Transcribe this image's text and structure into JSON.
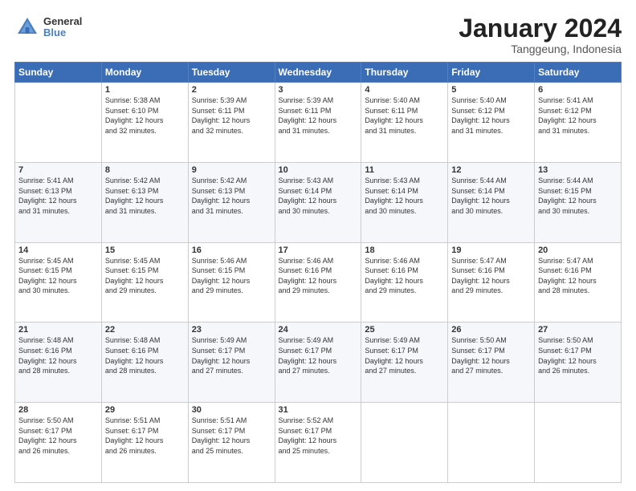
{
  "header": {
    "logo_line1": "General",
    "logo_line2": "Blue",
    "title": "January 2024",
    "subtitle": "Tanggeung, Indonesia"
  },
  "calendar": {
    "days_of_week": [
      "Sunday",
      "Monday",
      "Tuesday",
      "Wednesday",
      "Thursday",
      "Friday",
      "Saturday"
    ],
    "weeks": [
      [
        {
          "day": "",
          "info": ""
        },
        {
          "day": "1",
          "info": "Sunrise: 5:38 AM\nSunset: 6:10 PM\nDaylight: 12 hours\nand 32 minutes."
        },
        {
          "day": "2",
          "info": "Sunrise: 5:39 AM\nSunset: 6:11 PM\nDaylight: 12 hours\nand 32 minutes."
        },
        {
          "day": "3",
          "info": "Sunrise: 5:39 AM\nSunset: 6:11 PM\nDaylight: 12 hours\nand 31 minutes."
        },
        {
          "day": "4",
          "info": "Sunrise: 5:40 AM\nSunset: 6:11 PM\nDaylight: 12 hours\nand 31 minutes."
        },
        {
          "day": "5",
          "info": "Sunrise: 5:40 AM\nSunset: 6:12 PM\nDaylight: 12 hours\nand 31 minutes."
        },
        {
          "day": "6",
          "info": "Sunrise: 5:41 AM\nSunset: 6:12 PM\nDaylight: 12 hours\nand 31 minutes."
        }
      ],
      [
        {
          "day": "7",
          "info": "Sunrise: 5:41 AM\nSunset: 6:13 PM\nDaylight: 12 hours\nand 31 minutes."
        },
        {
          "day": "8",
          "info": "Sunrise: 5:42 AM\nSunset: 6:13 PM\nDaylight: 12 hours\nand 31 minutes."
        },
        {
          "day": "9",
          "info": "Sunrise: 5:42 AM\nSunset: 6:13 PM\nDaylight: 12 hours\nand 31 minutes."
        },
        {
          "day": "10",
          "info": "Sunrise: 5:43 AM\nSunset: 6:14 PM\nDaylight: 12 hours\nand 30 minutes."
        },
        {
          "day": "11",
          "info": "Sunrise: 5:43 AM\nSunset: 6:14 PM\nDaylight: 12 hours\nand 30 minutes."
        },
        {
          "day": "12",
          "info": "Sunrise: 5:44 AM\nSunset: 6:14 PM\nDaylight: 12 hours\nand 30 minutes."
        },
        {
          "day": "13",
          "info": "Sunrise: 5:44 AM\nSunset: 6:15 PM\nDaylight: 12 hours\nand 30 minutes."
        }
      ],
      [
        {
          "day": "14",
          "info": "Sunrise: 5:45 AM\nSunset: 6:15 PM\nDaylight: 12 hours\nand 30 minutes."
        },
        {
          "day": "15",
          "info": "Sunrise: 5:45 AM\nSunset: 6:15 PM\nDaylight: 12 hours\nand 29 minutes."
        },
        {
          "day": "16",
          "info": "Sunrise: 5:46 AM\nSunset: 6:15 PM\nDaylight: 12 hours\nand 29 minutes."
        },
        {
          "day": "17",
          "info": "Sunrise: 5:46 AM\nSunset: 6:16 PM\nDaylight: 12 hours\nand 29 minutes."
        },
        {
          "day": "18",
          "info": "Sunrise: 5:46 AM\nSunset: 6:16 PM\nDaylight: 12 hours\nand 29 minutes."
        },
        {
          "day": "19",
          "info": "Sunrise: 5:47 AM\nSunset: 6:16 PM\nDaylight: 12 hours\nand 29 minutes."
        },
        {
          "day": "20",
          "info": "Sunrise: 5:47 AM\nSunset: 6:16 PM\nDaylight: 12 hours\nand 28 minutes."
        }
      ],
      [
        {
          "day": "21",
          "info": "Sunrise: 5:48 AM\nSunset: 6:16 PM\nDaylight: 12 hours\nand 28 minutes."
        },
        {
          "day": "22",
          "info": "Sunrise: 5:48 AM\nSunset: 6:16 PM\nDaylight: 12 hours\nand 28 minutes."
        },
        {
          "day": "23",
          "info": "Sunrise: 5:49 AM\nSunset: 6:17 PM\nDaylight: 12 hours\nand 27 minutes."
        },
        {
          "day": "24",
          "info": "Sunrise: 5:49 AM\nSunset: 6:17 PM\nDaylight: 12 hours\nand 27 minutes."
        },
        {
          "day": "25",
          "info": "Sunrise: 5:49 AM\nSunset: 6:17 PM\nDaylight: 12 hours\nand 27 minutes."
        },
        {
          "day": "26",
          "info": "Sunrise: 5:50 AM\nSunset: 6:17 PM\nDaylight: 12 hours\nand 27 minutes."
        },
        {
          "day": "27",
          "info": "Sunrise: 5:50 AM\nSunset: 6:17 PM\nDaylight: 12 hours\nand 26 minutes."
        }
      ],
      [
        {
          "day": "28",
          "info": "Sunrise: 5:50 AM\nSunset: 6:17 PM\nDaylight: 12 hours\nand 26 minutes."
        },
        {
          "day": "29",
          "info": "Sunrise: 5:51 AM\nSunset: 6:17 PM\nDaylight: 12 hours\nand 26 minutes."
        },
        {
          "day": "30",
          "info": "Sunrise: 5:51 AM\nSunset: 6:17 PM\nDaylight: 12 hours\nand 25 minutes."
        },
        {
          "day": "31",
          "info": "Sunrise: 5:52 AM\nSunset: 6:17 PM\nDaylight: 12 hours\nand 25 minutes."
        },
        {
          "day": "",
          "info": ""
        },
        {
          "day": "",
          "info": ""
        },
        {
          "day": "",
          "info": ""
        }
      ]
    ]
  }
}
